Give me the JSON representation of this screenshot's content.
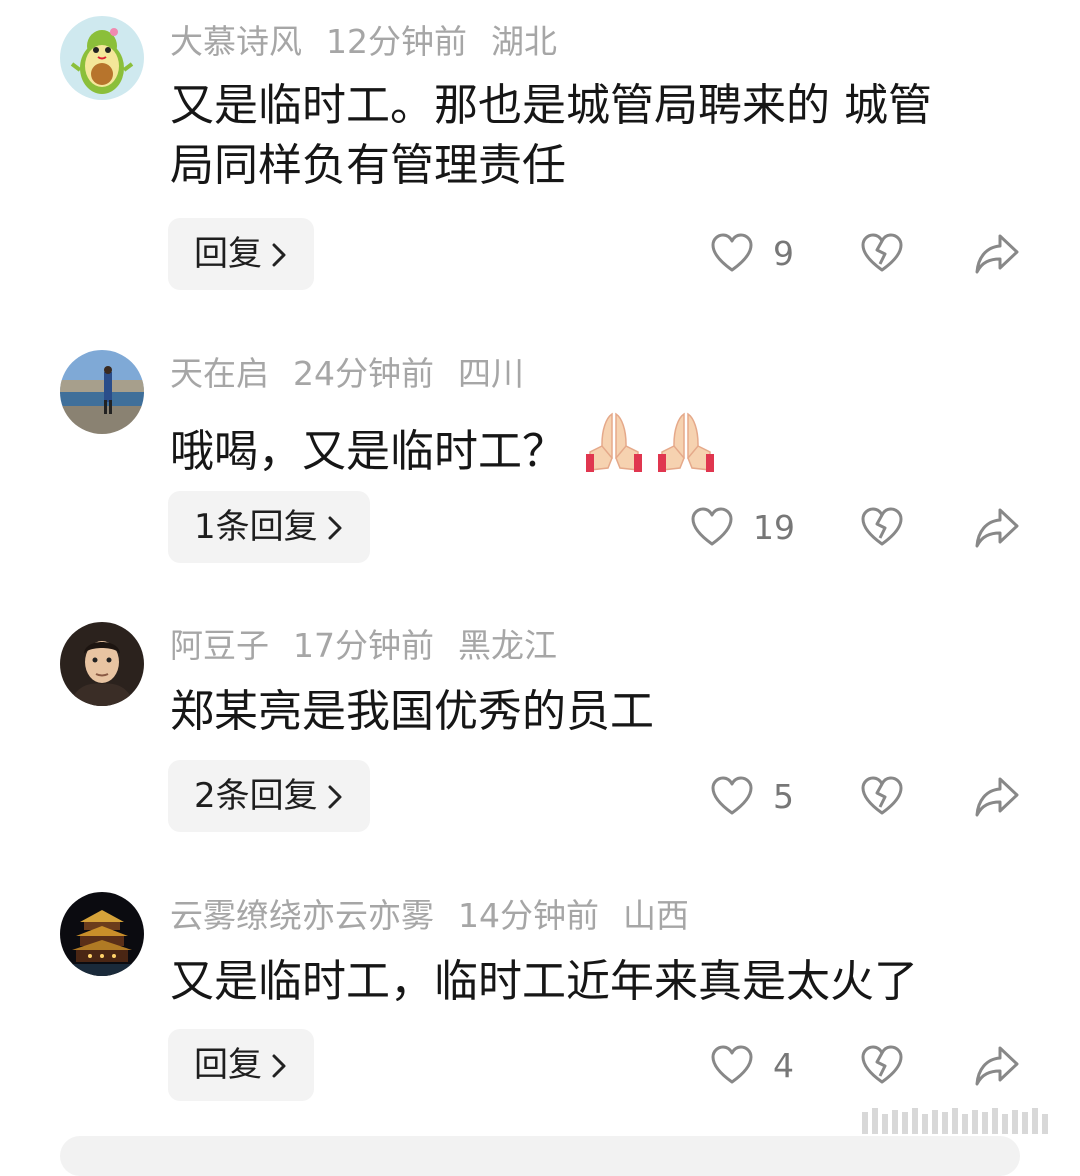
{
  "comments": [
    {
      "username": "大慕诗风",
      "time": "12分钟前",
      "location": "湖北",
      "text_lines": [
        "又是临时工。那也是城管局聘来的 城管",
        "局同样负有管理责任"
      ],
      "reply_label": "回复",
      "likes": "9",
      "avatar": "avocado-avatar"
    },
    {
      "username": "天在启",
      "time": "24分钟前",
      "location": "四川",
      "text_lines": [
        "哦喝，又是临时工？"
      ],
      "emoji": "folded-hands-emoji x2",
      "reply_label": "1条回复",
      "likes": "19",
      "avatar": "lakeside-photo-avatar"
    },
    {
      "username": "阿豆子",
      "time": "17分钟前",
      "location": "黑龙江",
      "text_lines": [
        "郑某亮是我国优秀的员工"
      ],
      "reply_label": "2条回复",
      "likes": "5",
      "avatar": "cartoon-man-avatar"
    },
    {
      "username": "云雾缭绕亦云亦雾",
      "time": "14分钟前",
      "location": "山西",
      "text_lines": [
        "又是临时工，临时工近年来真是太火了"
      ],
      "reply_label": "回复",
      "likes": "4",
      "avatar": "night-pagoda-avatar"
    }
  ],
  "colors": {
    "meta_gray": "#a6a6a6",
    "text": "#161616",
    "button_bg": "#f3f3f3",
    "icon": "#888888"
  },
  "icons": [
    "heart-icon",
    "broken-heart-icon",
    "share-arrow-icon",
    "chevron-right-icon"
  ]
}
